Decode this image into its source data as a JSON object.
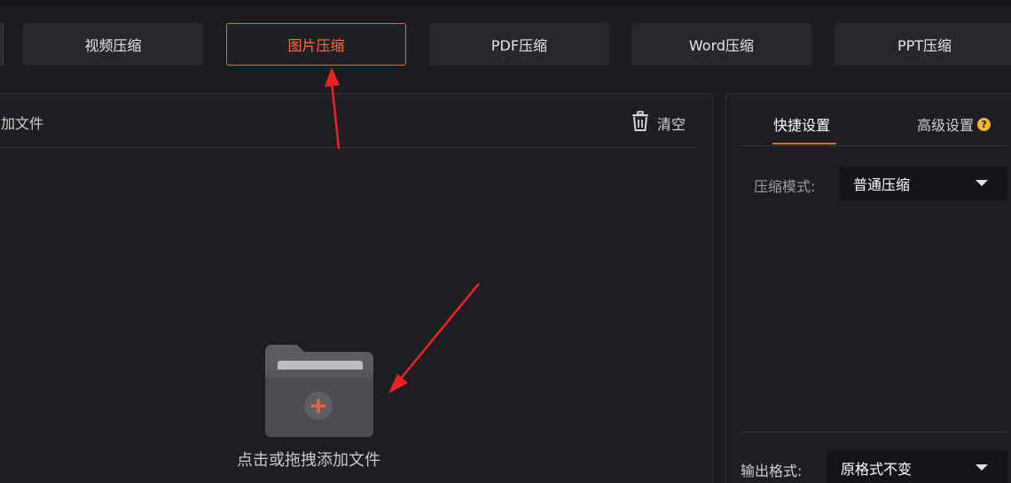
{
  "tabs": [
    {
      "label": "视频压缩",
      "active": false
    },
    {
      "label": "图片压缩",
      "active": true
    },
    {
      "label": "PDF压缩",
      "active": false
    },
    {
      "label": "Word压缩",
      "active": false
    },
    {
      "label": "PPT压缩",
      "active": false
    }
  ],
  "file_panel": {
    "add_file_label": "加文件",
    "clear_label": "清空",
    "drop_text": "点击或拖拽添加文件"
  },
  "settings": {
    "tab_quick": "快捷设置",
    "tab_advanced": "高级设置",
    "help_icon": "?",
    "compress_mode_label": "压缩模式:",
    "compress_mode_value": "普通压缩",
    "output_format_label": "输出格式:",
    "output_format_value": "原格式不变"
  },
  "colors": {
    "accent": "#e8643a",
    "background": "#1b1c20",
    "panel": "#1d1e22",
    "annotation_arrow": "#ee2222"
  },
  "icons": {
    "clear": "trash-icon",
    "folder": "folder-add-icon",
    "help": "question-icon",
    "dropdown": "caret-down-icon"
  }
}
